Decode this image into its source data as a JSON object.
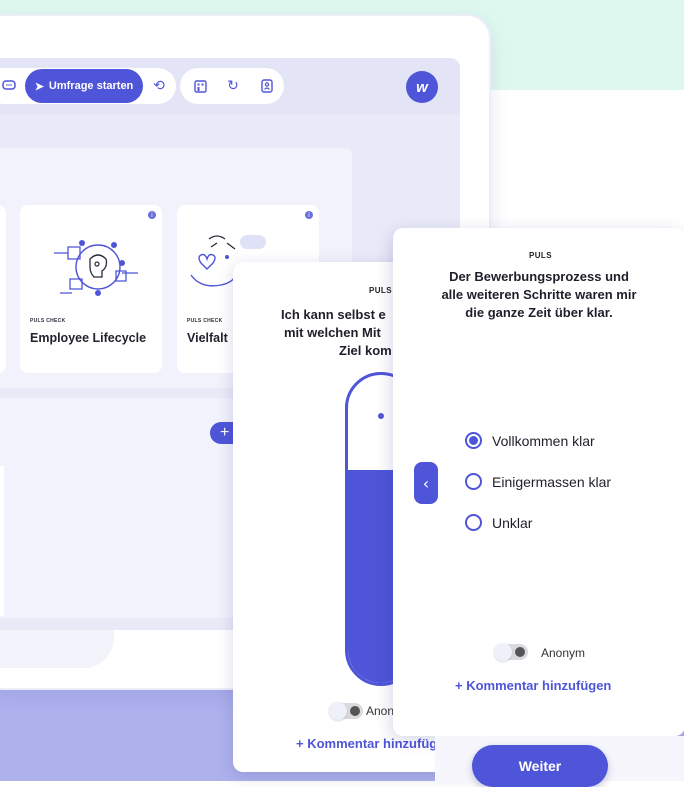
{
  "colors": {
    "accent": "#4f55d8",
    "mint": "#dff8ef",
    "lavender": "#a3a6e3"
  },
  "toolbar": {
    "start_survey_label": "Umfrage starten",
    "icons": [
      "chat-icon",
      "rocket-icon",
      "history-icon",
      "building-icon",
      "refresh-icon",
      "contacts-icon"
    ],
    "logo": "w"
  },
  "cards": [
    {
      "kicker": "PULS CHECK",
      "title": "Employee Lifecycle",
      "icon": "lifecycle-illustration"
    },
    {
      "kicker": "PULS CHECK",
      "title": "Vielfalt",
      "icon": "diversity-illustration"
    }
  ],
  "survey_back": {
    "kicker": "PULS",
    "question_lines": [
      "Ich kann selbst e",
      "mit welchen Mit",
      "Ziel kom"
    ],
    "anon_label": "Anon",
    "comment_label": "+ Kommentar hinzufügen",
    "slider_value_percent": 69
  },
  "survey_front": {
    "kicker": "PULS",
    "question_lines": [
      "Der Bewerbungsprozess und",
      "alle weiteren Schritte waren mir",
      "die ganze Zeit über klar."
    ],
    "options": [
      {
        "label": "Vollkommen klar",
        "selected": true
      },
      {
        "label": "Einigermassen klar",
        "selected": false
      },
      {
        "label": "Unklar",
        "selected": false
      }
    ],
    "anon_label": "Anonym",
    "comment_label": "+ Kommentar hinzufügen",
    "back_icon": "chevron-left-icon"
  },
  "next_button_label": "Weiter"
}
